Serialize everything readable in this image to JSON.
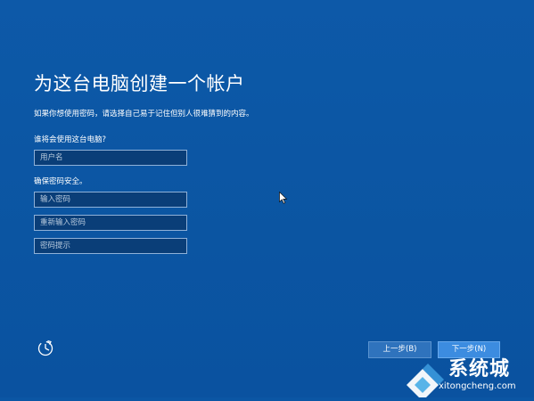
{
  "page": {
    "title": "为这台电脑创建一个帐户",
    "subtitle": "如果你想使用密码，请选择自己易于记住但别人很难猜到的内容。"
  },
  "user_section": {
    "label": "谁将会使用这台电脑?",
    "username_placeholder": "用户名"
  },
  "password_section": {
    "label": "确保密码安全。",
    "password_placeholder": "输入密码",
    "confirm_placeholder": "重新输入密码",
    "hint_placeholder": "密码提示"
  },
  "accessibility": {
    "icon": "ease-of-access-icon"
  },
  "buttons": {
    "back_label": "上一步(B)",
    "next_label": "下一步(N)"
  },
  "watermark": {
    "brand": "系统城",
    "url": "xitongcheng.com"
  },
  "colors": {
    "background": "#0b56a4",
    "field_background": "#0a3e78",
    "button_back": "#2f73bd",
    "button_next": "#3c8ce0"
  }
}
